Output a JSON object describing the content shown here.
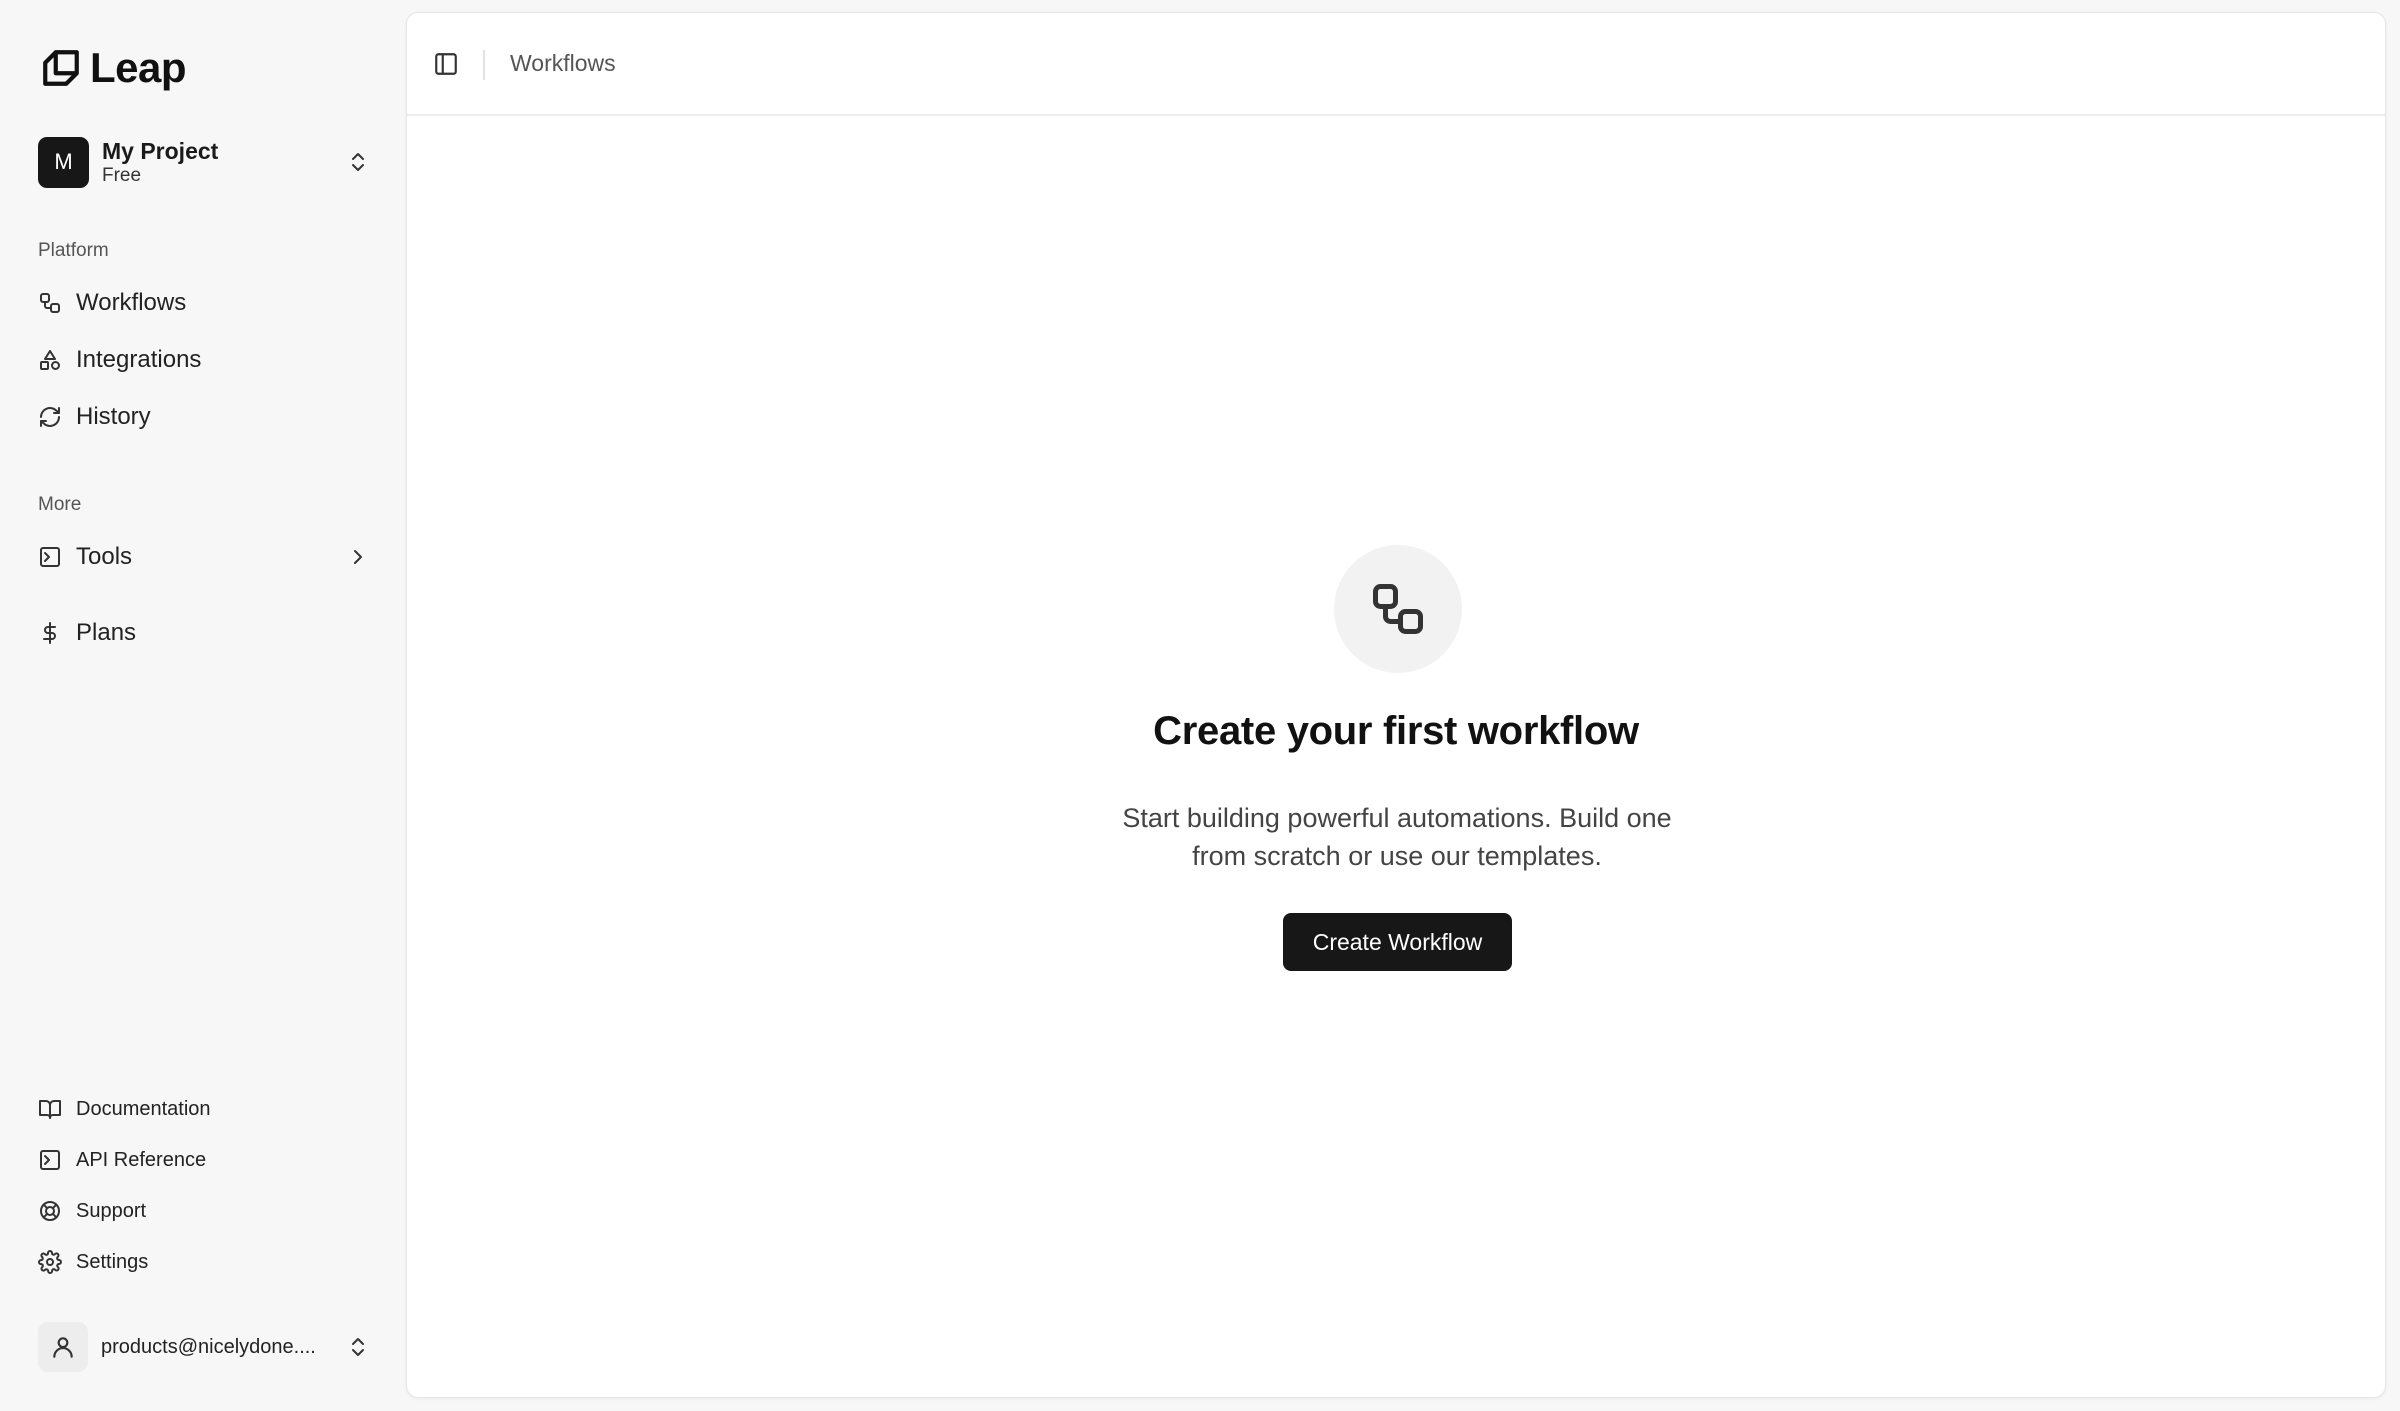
{
  "brand": {
    "name": "Leap",
    "icon": "leap-logo"
  },
  "project": {
    "avatar_letter": "M",
    "name": "My Project",
    "plan": "Free",
    "switcher_icon": "chevrons-up-down-icon"
  },
  "sidebar": {
    "platform_label": "Platform",
    "platform_items": [
      {
        "label": "Workflows",
        "icon": "workflow-icon"
      },
      {
        "label": "Integrations",
        "icon": "shapes-icon"
      },
      {
        "label": "History",
        "icon": "refresh-icon"
      }
    ],
    "more_label": "More",
    "more_items": [
      {
        "label": "Tools",
        "icon": "terminal-icon",
        "expand_icon": "chevron-right-icon"
      },
      {
        "label": "Plans",
        "icon": "dollar-icon"
      }
    ],
    "footer_items": [
      {
        "label": "Documentation",
        "icon": "book-icon"
      },
      {
        "label": "API Reference",
        "icon": "terminal-icon"
      },
      {
        "label": "Support",
        "icon": "life-buoy-icon"
      },
      {
        "label": "Settings",
        "icon": "gear-icon"
      }
    ],
    "user": {
      "email": "products@nicelydone....",
      "icon": "user-icon"
    }
  },
  "topbar": {
    "toggle_icon": "sidebar-toggle-icon",
    "breadcrumb": "Workflows"
  },
  "empty_state": {
    "icon": "workflow-icon",
    "title": "Create your first workflow",
    "description": "Start building powerful automations. Build one from scratch or use our templates.",
    "button_label": "Create Workflow"
  },
  "colors": {
    "primary": "#171717",
    "sidebar_bg": "#f7f7f7",
    "panel_bg": "#ffffff"
  }
}
